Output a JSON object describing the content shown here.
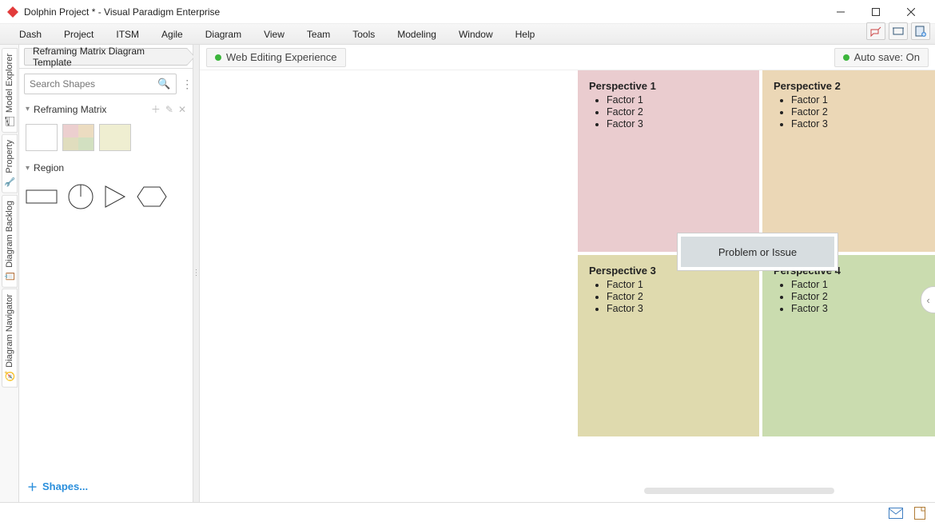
{
  "window": {
    "title": "Dolphin Project * - Visual Paradigm Enterprise"
  },
  "menu": [
    "Dash",
    "Project",
    "ITSM",
    "Agile",
    "Diagram",
    "View",
    "Team",
    "Tools",
    "Modeling",
    "Window",
    "Help"
  ],
  "breadcrumb": "Reframing Matrix Diagram Template",
  "search": {
    "placeholder": "Search Shapes"
  },
  "side_tabs": [
    "Model Explorer",
    "Property",
    "Diagram Backlog",
    "Diagram Navigator"
  ],
  "palette": {
    "section1": "Reframing Matrix",
    "section2": "Region",
    "shapes_link": "Shapes..."
  },
  "canvas": {
    "tab_label": "Web Editing Experience",
    "autosave": "Auto save: On",
    "center": "Problem or Issue",
    "quads": [
      {
        "title": "Perspective 1",
        "factors": [
          "Factor 1",
          "Factor 2",
          "Factor 3"
        ]
      },
      {
        "title": "Perspective 2",
        "factors": [
          "Factor 1",
          "Factor 2",
          "Factor 3"
        ]
      },
      {
        "title": "Perspective 3",
        "factors": [
          "Factor 1",
          "Factor 2",
          "Factor 3"
        ]
      },
      {
        "title": "Perspective 4",
        "factors": [
          "Factor 1",
          "Factor 2",
          "Factor 3"
        ]
      }
    ]
  }
}
